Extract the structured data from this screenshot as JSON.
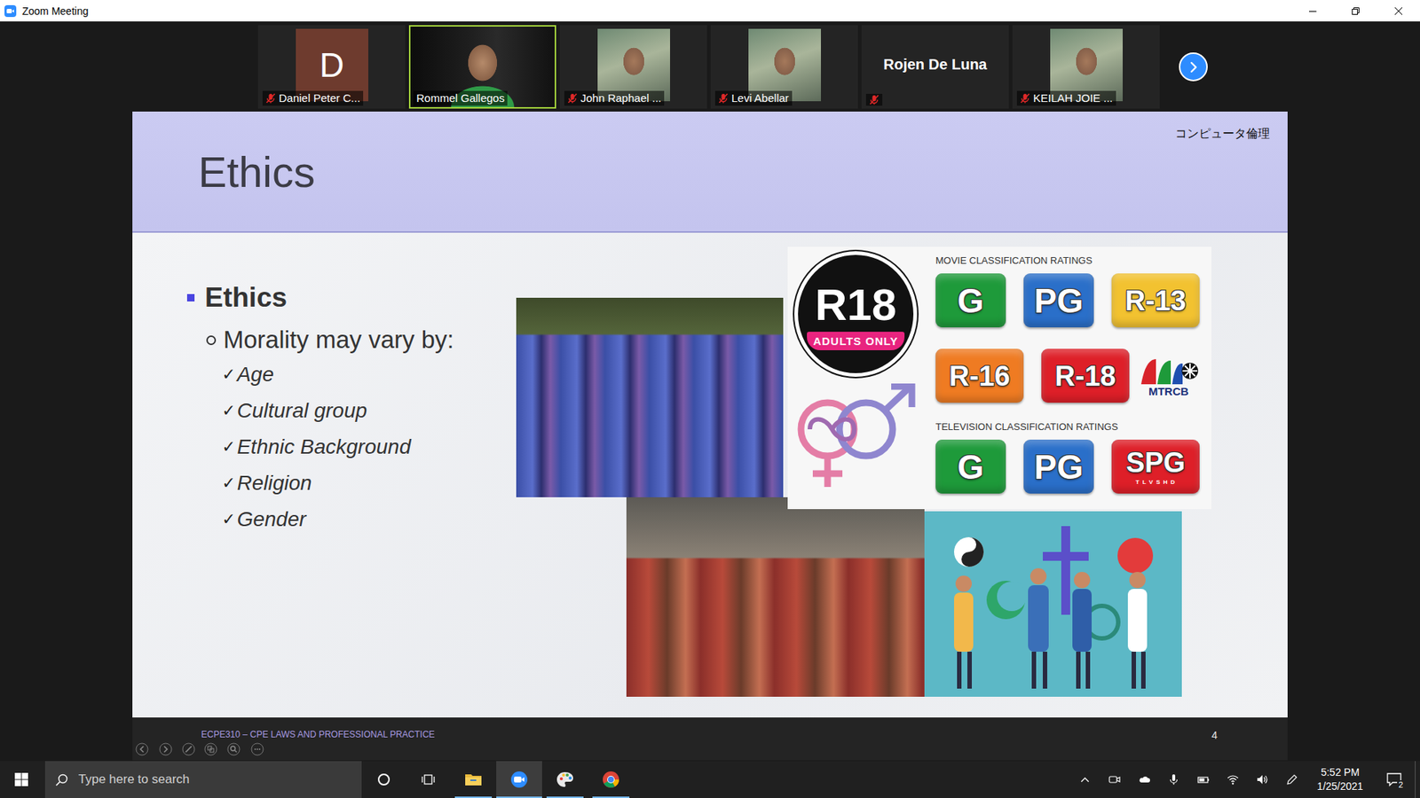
{
  "window": {
    "title": "Zoom Meeting"
  },
  "participants": [
    {
      "name": "Daniel Peter C...",
      "kind": "avatar",
      "initial": "D",
      "muted": true,
      "speaking": false
    },
    {
      "name": "Rommel Gallegos",
      "kind": "video",
      "muted": false,
      "speaking": true
    },
    {
      "name": "John Raphael ...",
      "kind": "video",
      "muted": true,
      "speaking": false
    },
    {
      "name": "Levi Abellar",
      "kind": "video",
      "muted": true,
      "speaking": false
    },
    {
      "name": "Rojen De Luna",
      "kind": "name",
      "muted": true,
      "speaking": false
    },
    {
      "name": "KEILAH JOIE ...",
      "kind": "video",
      "muted": true,
      "speaking": false
    }
  ],
  "slide": {
    "corner_label": "コンピュータ倫理",
    "title": "Ethics",
    "bullet": "Ethics",
    "sub_bullet": "Morality may vary by:",
    "check_mark": "✓",
    "items": [
      "Age",
      "Cultural group",
      "Ethnic Background",
      "Religion",
      "Gender"
    ],
    "ratings": {
      "badge_label": "R18",
      "badge_sub": "ADULTS ONLY",
      "movie_title": "MOVIE CLASSIFICATION RATINGS",
      "movie": [
        {
          "label": "G",
          "color": "#1e9a3a"
        },
        {
          "label": "PG",
          "color": "#2a6fc9"
        },
        {
          "label": "R-13",
          "color": "#f2c230"
        },
        {
          "label": "R-16",
          "color": "#ef7b22"
        },
        {
          "label": "R-18",
          "color": "#de1f28"
        }
      ],
      "logo": "MTRCB",
      "tv_title": "TELEVISION CLASSIFICATION RATINGS",
      "tv": [
        {
          "label": "G",
          "color": "#1e9a3a"
        },
        {
          "label": "PG",
          "color": "#2a6fc9"
        },
        {
          "label": "SPG",
          "color": "#de1f28",
          "sub": "T L V S H D"
        }
      ]
    },
    "footer": "ECPE310 – CPE LAWS AND PROFESSIONAL PRACTICE",
    "page": "4"
  },
  "taskbar": {
    "search_placeholder": "Type here to search",
    "apps": [
      {
        "kind": "explorer",
        "running": true,
        "active": false
      },
      {
        "kind": "zoom",
        "running": true,
        "active": true
      },
      {
        "kind": "paint",
        "running": true,
        "active": false
      },
      {
        "kind": "chrome",
        "running": true,
        "active": false
      }
    ],
    "time": "5:52 PM",
    "date": "1/25/2021",
    "notifications": "2"
  }
}
